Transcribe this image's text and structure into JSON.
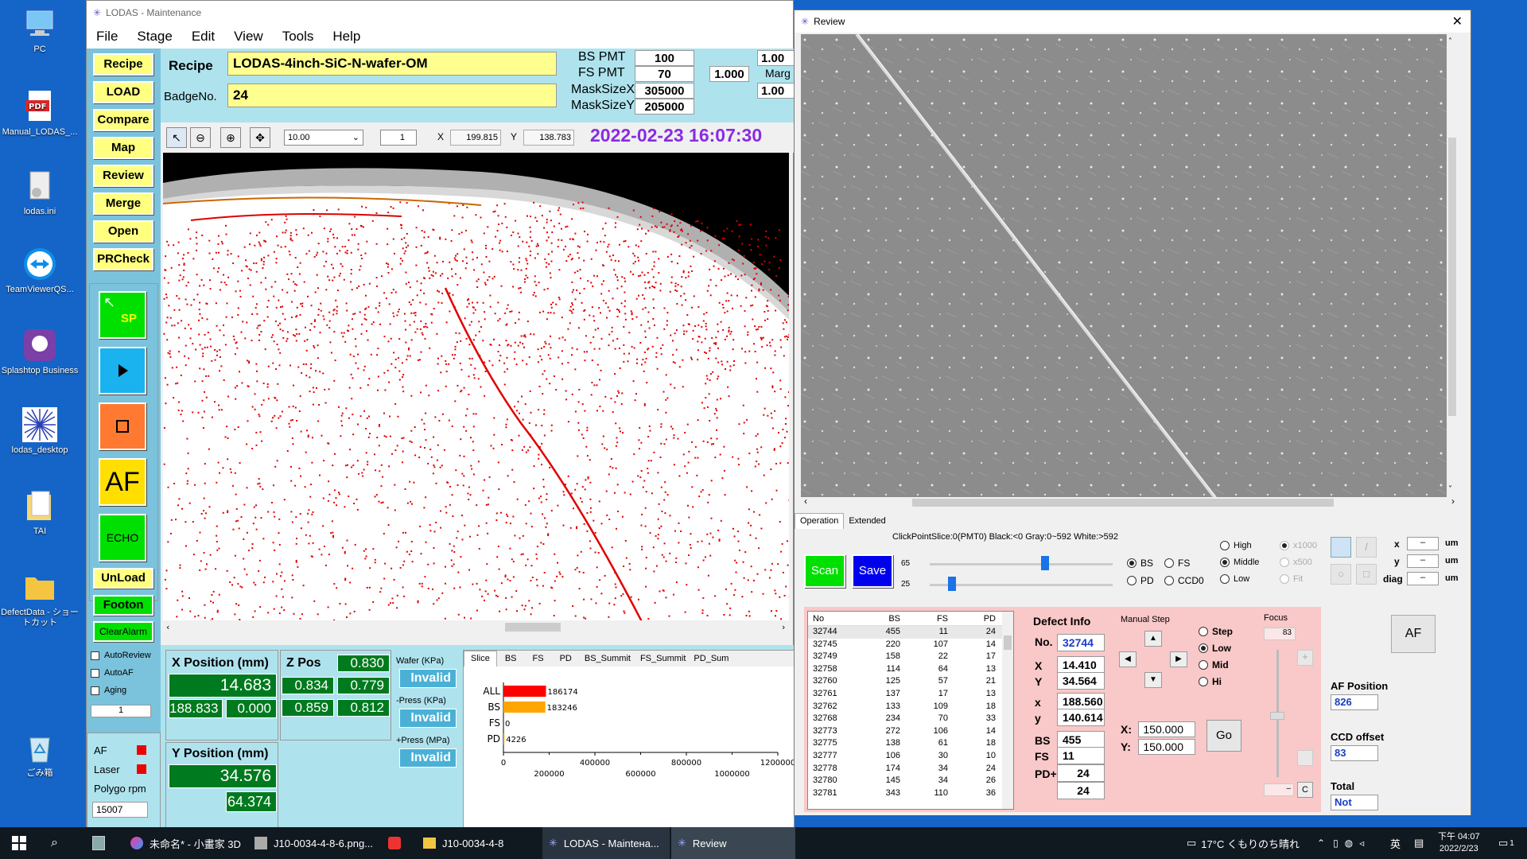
{
  "desktop": {
    "icons": [
      {
        "label": "PC",
        "icon": "pc-icon"
      },
      {
        "label": "Manual_LODAS_...",
        "icon": "pdf-icon"
      },
      {
        "label": "lodas.ini",
        "icon": "file-icon"
      },
      {
        "label": "TeamViewerQS...",
        "icon": "teamviewer-icon"
      },
      {
        "label": "Splashtop Business",
        "icon": "splashtop-icon"
      },
      {
        "label": "lodas_desktop",
        "icon": "starburst-icon"
      },
      {
        "label": "TAI",
        "icon": "folder-icon"
      },
      {
        "label": "DefectData - ショートカット",
        "icon": "folder-icon"
      },
      {
        "label": "ごみ箱",
        "icon": "recycle-bin-icon"
      }
    ]
  },
  "main": {
    "title": "LODAS - Maintenance",
    "menu": [
      "File",
      "Stage",
      "Edit",
      "View",
      "Tools",
      "Help"
    ],
    "left_buttons": [
      "Recipe",
      "LOAD",
      "Compare",
      "Map",
      "Review",
      "Merge",
      "Open",
      "PRCheck"
    ],
    "sp_label": "SP",
    "af_label": "AF",
    "echo_label": "ECHO",
    "unload_label": "UnLoad",
    "footon_label": "Footon",
    "clearalarm_label": "ClearAlarm",
    "checks": [
      "AutoReview",
      "AutoAF",
      "Aging"
    ],
    "spin_value": "1",
    "recipe_label": "Recipe",
    "recipe_value": "LODAS-4inch-SiC-N-wafer-OM",
    "badge_label": "BadgeNo.",
    "badge_value": "24",
    "bs_pmt_label": "BS PMT",
    "bs_pmt_value": "100",
    "fs_pmt_label": "FS PMT",
    "fs_pmt_value": "70",
    "masksizex_label": "MaskSizeX",
    "masksizex_value": "305000",
    "masksizey_label": "MaskSizeY",
    "masksizey_value": "205000",
    "right_val1": "1.00",
    "right_val2": "1.000",
    "marg_label": "Marg",
    "right_val3": "1.00",
    "zoom_value": "10.00",
    "page_value": "1",
    "x_label": "X",
    "x_value": "199.815",
    "y_label": "Y",
    "y_value": "138.783",
    "datetime": "2022-02-23 16:07:30",
    "xpos_label": "X Position (mm)",
    "xpos_value": "14.683",
    "xpos_sub1": "188.833",
    "xpos_sub2": "0.000",
    "zpos_label": "Z Pos",
    "zpos_v1": "0.830",
    "zpos_v2": "0.834",
    "zpos_v3": "0.779",
    "zpos_v4": "0.859",
    "zpos_v5": "0.812",
    "ypos_label": "Y Position (mm)",
    "ypos_value": "34.576",
    "ypos_sub": "64.374",
    "af_status": "AF",
    "laser_status": "Laser",
    "polygo_label": "Polygo rpm",
    "polygo_value": "15007",
    "wafer_label": "Wafer (KPa)",
    "wafer_value": "Invalid",
    "press_minus_label": "-Press (KPa)",
    "press_minus_value": "Invalid",
    "press_plus_label": "+Press (MPa)",
    "press_plus_value": "Invalid",
    "chart_tabs": [
      "Slice",
      "BS",
      "FS",
      "PD",
      "BS_Summit",
      "FS_Summit",
      "PD_Sum"
    ]
  },
  "chart_data": {
    "type": "bar",
    "orientation": "horizontal",
    "categories": [
      "ALL",
      "BS",
      "FS",
      "PD"
    ],
    "values": [
      186174,
      183246,
      0,
      4226
    ],
    "value_labels": [
      "186174",
      "183246",
      "0",
      "4226"
    ],
    "colors": [
      "#ff0000",
      "#ffa500",
      "#ffa500",
      "#ffa500"
    ],
    "xlim": [
      0,
      1200000
    ],
    "xticks_top": [
      "0",
      "400000",
      "800000",
      "1200000"
    ],
    "xticks_bottom": [
      "200000",
      "600000",
      "1000000"
    ]
  },
  "review": {
    "title": "Review",
    "tabs": [
      "Operation",
      "Extended"
    ],
    "click_info": "ClickPointSlice:0(PMT0) Black:<0 Gray:0~592 White:>592",
    "scan_label": "Scan",
    "save_label": "Save",
    "slider1_value": "65",
    "slider2_value": "25",
    "radio_bs": "BS",
    "radio_fs": "FS",
    "radio_pd": "PD",
    "radio_ccd0": "CCD0",
    "radio_high": "High",
    "radio_middle": "Middle",
    "radio_low": "Low",
    "radio_x1000": "x1000",
    "radio_x500": "x500",
    "radio_fit": "Fit",
    "meas_x_label": "x",
    "meas_y_label": "y",
    "meas_diag_label": "diag",
    "meas_x_value": "–",
    "meas_y_value": "–",
    "meas_diag_value": "–",
    "meas_unit": "um",
    "af_button": "AF",
    "table_headers": [
      "No",
      "BS",
      "FS",
      "PD"
    ],
    "table_rows": [
      [
        "32744",
        "455",
        "11",
        "24"
      ],
      [
        "32745",
        "220",
        "107",
        "14"
      ],
      [
        "32749",
        "158",
        "22",
        "17"
      ],
      [
        "32758",
        "114",
        "64",
        "13"
      ],
      [
        "32760",
        "125",
        "57",
        "21"
      ],
      [
        "32761",
        "137",
        "17",
        "13"
      ],
      [
        "32762",
        "133",
        "109",
        "18"
      ],
      [
        "32768",
        "234",
        "70",
        "33"
      ],
      [
        "32773",
        "272",
        "106",
        "14"
      ],
      [
        "32775",
        "138",
        "61",
        "18"
      ],
      [
        "32777",
        "106",
        "30",
        "10"
      ],
      [
        "32778",
        "174",
        "34",
        "24"
      ],
      [
        "32780",
        "145",
        "34",
        "26"
      ],
      [
        "32781",
        "343",
        "110",
        "36"
      ]
    ],
    "defect_info_label": "Defect Info",
    "no_label": "No.",
    "no_value": "32744",
    "X_label": "X",
    "X_value": "14.410",
    "Y_label": "Y",
    "Y_value": "34.564",
    "x_label": "x",
    "x_value": "188.560",
    "y_label": "y",
    "y_value": "140.614",
    "bs_label": "BS",
    "bs_value": "455",
    "fs_label": "FS",
    "fs_value": "11",
    "pd_label": "PD+",
    "pd_value1": "24",
    "pd_value2": "24",
    "manual_step_label": "Manual Step",
    "step_radio": "Step",
    "low_radio": "Low",
    "mid_radio": "Mid",
    "hi_radio": "Hi",
    "go_x_label": "X:",
    "go_x_value": "150.000",
    "go_y_label": "Y:",
    "go_y_value": "150.000",
    "go_label": "Go",
    "focus_label": "Focus",
    "focus_value": "83",
    "focus_minus": "–",
    "focus_c": "C",
    "af_position_label": "AF Position",
    "af_position_value": "826",
    "ccd_offset_label": "CCD offset",
    "ccd_offset_value": "83",
    "total_label": "Total",
    "total_value": "Not"
  },
  "taskbar": {
    "items": [
      "未命名* - 小畫家 3D",
      "J10-0034-4-8-6.png...",
      "J10-0034-4-8",
      "LODAS - Mainteна...",
      "Review"
    ],
    "weather": "17°C くもりのち晴れ",
    "ime": "英",
    "time": "下午 04:07",
    "date": "2022/2/23",
    "notif_count": "1"
  }
}
